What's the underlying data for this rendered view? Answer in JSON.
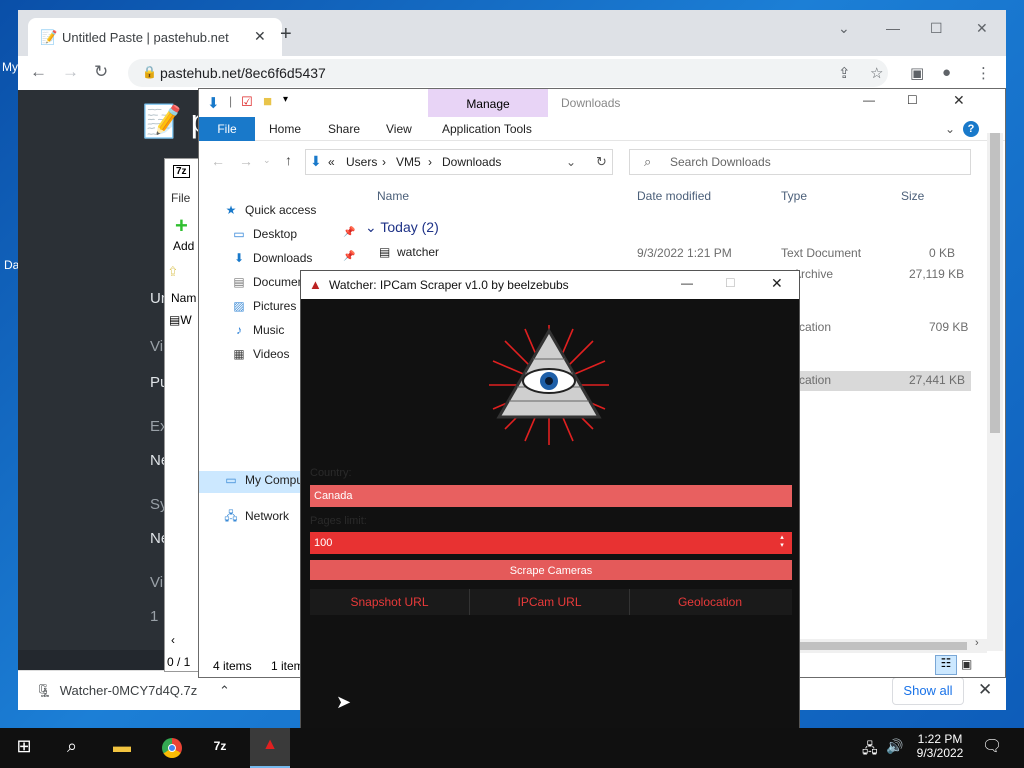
{
  "desktop": {
    "frag_my": "My",
    "frag_da": "Da",
    "frag_bar": "I"
  },
  "browser": {
    "tab_title": "Untitled Paste | pastehub.net",
    "new_tab": "+",
    "url": "pastehub.net/8ec6f6d5437",
    "page_logo": "p",
    "page_left": {
      "un": "Un",
      "vi": "Vi",
      "pu": "Pu",
      "ex": "Ex",
      "ne1": "Ne",
      "sy": "Sy",
      "ne2": "Ne",
      "vi2": "Vi",
      "num": "1"
    },
    "download_item": "Watcher-0MCY7d4Q.7z",
    "show_all": "Show all"
  },
  "sevenzip": {
    "file_menu": "File",
    "add_label": "Add",
    "name_col": "Nam",
    "row_prefix": "W",
    "status": "0 / 1"
  },
  "explorer": {
    "title_downloads": "Downloads",
    "manage_tab": "Manage",
    "ribbon_tabs": [
      "File",
      "Home",
      "Share",
      "View",
      "Application Tools"
    ],
    "breadcrumb": [
      "Users",
      "VM5",
      "Downloads"
    ],
    "search_placeholder": "Search Downloads",
    "nav": [
      "Quick access",
      "Desktop",
      "Downloads",
      "Documents",
      "Pictures",
      "Music",
      "Videos",
      "My Computer",
      "Network"
    ],
    "columns": [
      "Name",
      "Date modified",
      "Type",
      "Size"
    ],
    "group": "Today (2)",
    "rows": [
      {
        "name": "watcher",
        "date": "9/3/2022 1:21 PM",
        "type": "Text Document",
        "size": "0 KB"
      },
      {
        "name": "",
        "date": "",
        "type": "Archive",
        "size": "27,119 KB"
      },
      {
        "name": "",
        "date": "",
        "type": "plication",
        "size": "709 KB"
      },
      {
        "name": "",
        "date": "",
        "type": "plication",
        "size": "27,441 KB"
      }
    ],
    "status_items": "4 items",
    "status_sel": "1 item"
  },
  "watcher": {
    "title": "Watcher: IPCam Scraper v1.0 by beelzebubs",
    "country_label": "Country:",
    "country_value": "Canada",
    "pages_label": "Pages limit:",
    "pages_value": "100",
    "scrape_button": "Scrape Cameras",
    "tabs": [
      "Snapshot URL",
      "IPCam URL",
      "Geolocation"
    ]
  },
  "taskbar": {
    "time": "1:22 PM",
    "date": "9/3/2022"
  },
  "colors": {
    "accent_red": "#e83232",
    "explorer_file_tab": "#1979ca",
    "manage_tab": "#e8d4f6"
  }
}
